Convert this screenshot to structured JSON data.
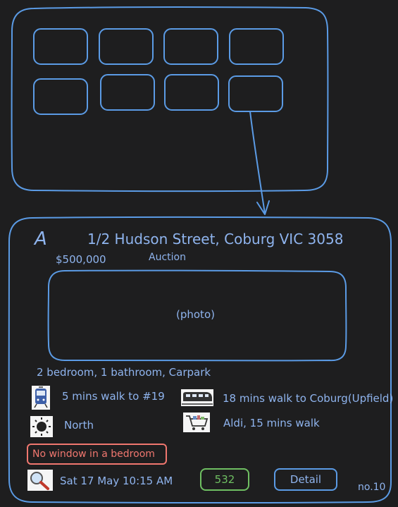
{
  "listing": {
    "letter": "A",
    "address": "1/2 Hudson Street, Coburg VIC 3058",
    "price": "$500,000",
    "sale_method": "Auction",
    "photo_placeholder": "(photo)",
    "rooms": "2 bedroom, 1 bathroom, Carpark",
    "tram": "5 mins walk to #19",
    "train": "18 mins walk to Coburg(Upfield)",
    "orientation": "North",
    "shop": "Aldi, 15 mins walk",
    "warning": "No window in a bedroom",
    "inspection": "Sat 17 May 10:15 AM",
    "score": "532",
    "detail_button": "Detail",
    "number": "no.10"
  },
  "icons": {
    "tram": "tram-icon",
    "train": "train-icon",
    "sun": "sun-icon",
    "cart": "shopping-cart-icon",
    "search": "magnifier-icon"
  },
  "colors": {
    "background": "#1e1e1f",
    "stroke": "#5b9be5",
    "text": "#8fb4ee",
    "warning": "#f0776f",
    "score": "#6fbf62"
  }
}
